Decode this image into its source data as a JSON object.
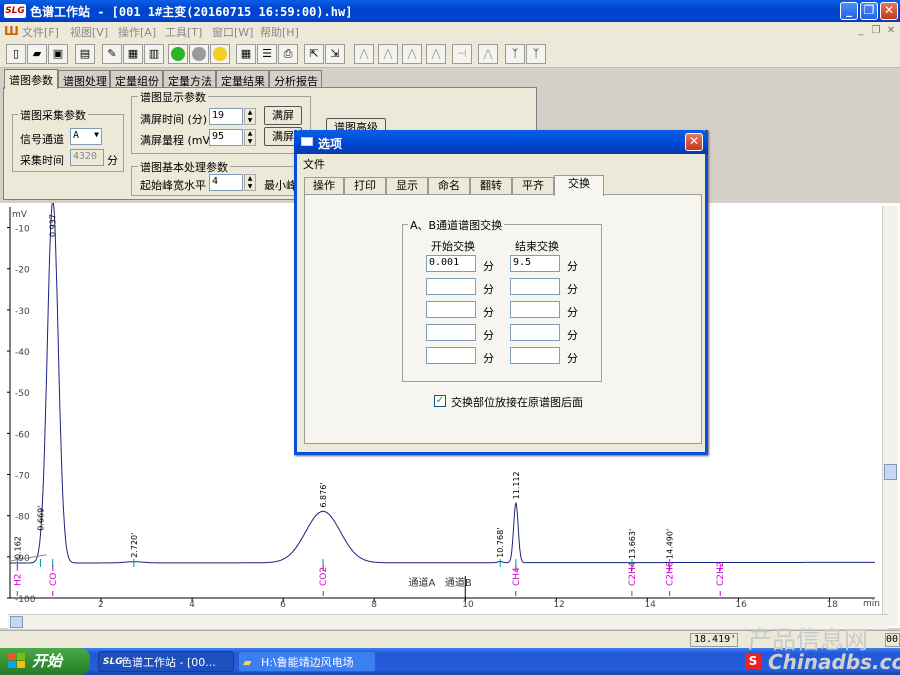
{
  "window": {
    "app_icon": "SLG",
    "title": "色谱工作站 - [001 1#主变(20160715 16:59:00).hw]"
  },
  "menu": [
    "文件[F]",
    "视图[V]",
    "操作[A]",
    "工具[T]",
    "窗口[W]",
    "帮助[H]"
  ],
  "main_tabs": [
    "谱图参数",
    "谱图处理",
    "定量组份",
    "定量方法",
    "定量结果",
    "分析报告"
  ],
  "acq": {
    "title": "谱图采集参数",
    "channel_label": "信号通道",
    "channel_value": "A",
    "time_label": "采集时间",
    "time_value": "4320",
    "time_unit": "分"
  },
  "disp": {
    "title": "谱图显示参数",
    "full_time_label": "满屏时间 (分)",
    "full_time_value": "19",
    "full_range_label": "满屏量程 (mV)",
    "full_range_value": "95",
    "btn1": "满屏",
    "btn2": "满屏"
  },
  "hidden_btn": "谱图高级",
  "base": {
    "title": "谱图基本处理参数",
    "width_label": "起始峰宽水平",
    "width_value": "4",
    "min_label": "最小峰"
  },
  "dialog": {
    "title": "选项",
    "menu": "文件",
    "tabs": [
      "操作",
      "打印",
      "显示",
      "命名",
      "翻转",
      "平齐",
      "交换"
    ],
    "group_title": "A、B通道谱图交换",
    "start_header": "开始交换",
    "end_header": "结束交换",
    "unit": "分",
    "rows": [
      {
        "start": "0.001",
        "end": "9.5"
      },
      {
        "start": "",
        "end": ""
      },
      {
        "start": "",
        "end": ""
      },
      {
        "start": "",
        "end": ""
      },
      {
        "start": "",
        "end": ""
      }
    ],
    "checkbox_label": "交换部位放接在原谱图后面",
    "checkbox_checked": true
  },
  "status": {
    "cell1": "18.419'",
    "cell2": "00"
  },
  "taskbar": {
    "start": "开始",
    "task1": "色谱工作站 - [00...",
    "task2": "H:\\鲁能靖边风电场"
  },
  "watermark": {
    "line1": "产品信息网",
    "line2": "Chinadbs.com"
  },
  "chart_data": {
    "type": "line",
    "ylabel": "mV",
    "xlabel": "min",
    "xlim": [
      0,
      19
    ],
    "ylim": [
      -100,
      -5
    ],
    "x_ticks": [
      2,
      4,
      6,
      8,
      10,
      12,
      14,
      16,
      18
    ],
    "y_ticks": [
      -10,
      -20,
      -30,
      -40,
      -50,
      -60,
      -70,
      -80,
      -90,
      -100
    ],
    "peak_labels": [
      {
        "t": 0.162,
        "label": "0.162"
      },
      {
        "t": 0.669,
        "label": "0.669'"
      },
      {
        "t": 0.937,
        "label": "0.937"
      },
      {
        "t": 2.72,
        "label": "2.720'"
      },
      {
        "t": 6.876,
        "label": "6.876'"
      },
      {
        "t": 10.768,
        "label": "10.768'"
      },
      {
        "t": 11.112,
        "label": "11.112"
      },
      {
        "t": 13.663,
        "label": "13.663'"
      },
      {
        "t": 14.49,
        "label": "14.490'"
      }
    ],
    "components": [
      {
        "t": 0.16,
        "name": "H2"
      },
      {
        "t": 0.94,
        "name": "CO"
      },
      {
        "t": 6.88,
        "name": "CO2"
      },
      {
        "t": 11.11,
        "name": "CH4"
      },
      {
        "t": 13.66,
        "name": "C2H4"
      },
      {
        "t": 14.49,
        "name": "C2H6"
      },
      {
        "t": 15.6,
        "name": "C2H2"
      }
    ],
    "channel_labels": [
      {
        "t": 9.5,
        "name": "通道A"
      },
      {
        "t": 10.3,
        "name": "通道B"
      }
    ],
    "baseline": -91.5,
    "peaks": [
      {
        "t": 0.94,
        "h": 88,
        "w": 0.12
      },
      {
        "t": 6.876,
        "h": 12.5,
        "w": 0.38
      },
      {
        "t": 11.112,
        "h": 14.5,
        "w": 0.05
      },
      {
        "t": 2.72,
        "h": 0.3,
        "w": 0.2
      },
      {
        "t": 10.768,
        "h": 0.3,
        "w": 0.05
      }
    ],
    "line_color": "#1a237e",
    "label_color": "#cc00cc",
    "tick_color": "#009999"
  }
}
